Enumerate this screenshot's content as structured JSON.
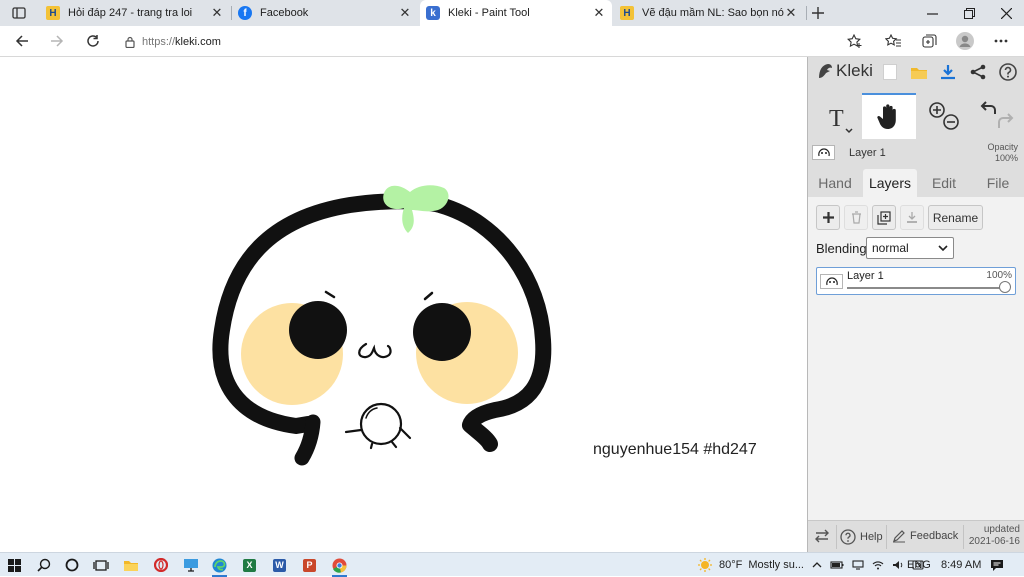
{
  "browser": {
    "tabs": [
      {
        "title": "Hỏi đáp 247 - trang tra loi",
        "favicon": "hoidap247-icon",
        "active": false
      },
      {
        "title": "Facebook",
        "favicon": "facebook-icon",
        "active": false
      },
      {
        "title": "Kleki - Paint Tool",
        "favicon": "kleki-icon",
        "active": true
      },
      {
        "title": "Vẽ đậu mầm NL: Sao bọn nó yêu",
        "favicon": "hoidap247-icon",
        "active": false
      }
    ],
    "close_glyph": "✕",
    "url_scheme": "https://",
    "url_host": "kleki.com"
  },
  "canvas": {
    "signature": "nguyenhue154 #hd247"
  },
  "kleki": {
    "logo": "Kleki",
    "layer_mini": {
      "name": "Layer 1",
      "opacity_label": "Opacity",
      "opacity_value": "100%"
    },
    "panel_tabs": [
      "Hand",
      "Layers",
      "Edit",
      "File"
    ],
    "active_tab": "Layers",
    "rename_label": "Rename",
    "blending_label": "Blending",
    "blending_value": "normal",
    "layer": {
      "name": "Layer 1",
      "opacity": "100%",
      "opacity_fraction": 1.0
    },
    "footer": {
      "help_label": "Help",
      "feedback_label": "Feedback",
      "updated_label": "updated",
      "updated_date": "2021-06-16"
    }
  },
  "taskbar": {
    "weather_temp": "80°F",
    "weather_text": "Mostly su...",
    "language": "ENG",
    "time": "8:49 AM"
  },
  "colors": {
    "accent": "#4a8fdc",
    "panel_bg": "#dedede",
    "sprout_green": "#b4f2a4",
    "cheek_yellow": "#fde1a2",
    "download_blue": "#1a73d6"
  }
}
